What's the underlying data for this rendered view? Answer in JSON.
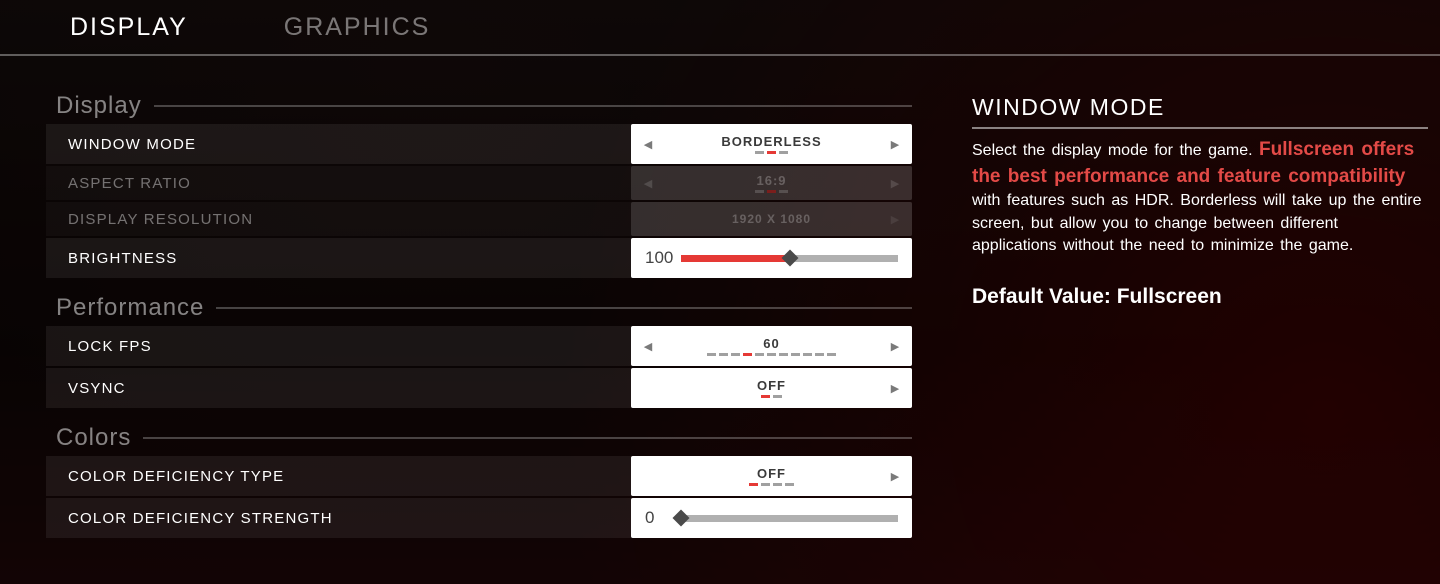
{
  "tabs": {
    "display": "DISPLAY",
    "graphics": "GRAPHICS"
  },
  "sections": {
    "display": "Display",
    "performance": "Performance",
    "colors": "Colors"
  },
  "rows": {
    "window_mode": {
      "label": "WINDOW MODE",
      "value": "BORDERLESS",
      "count": 3,
      "active": 1,
      "left": true,
      "right": true
    },
    "aspect_ratio": {
      "label": "ASPECT RATIO",
      "value": "16:9",
      "count": 3,
      "active": 1,
      "left": true,
      "right": true
    },
    "resolution": {
      "label": "DISPLAY RESOLUTION",
      "value": "1920 X 1080"
    },
    "brightness": {
      "label": "BRIGHTNESS",
      "value": "100",
      "percent": 50
    },
    "lock_fps": {
      "label": "LOCK FPS",
      "value": "60",
      "count": 11,
      "active": 3,
      "left": true,
      "right": true
    },
    "vsync": {
      "label": "VSYNC",
      "value": "OFF",
      "count": 2,
      "active": 0,
      "left": false,
      "right": true
    },
    "cd_type": {
      "label": "COLOR DEFICIENCY TYPE",
      "value": "OFF",
      "count": 4,
      "active": 0,
      "left": false,
      "right": true
    },
    "cd_strength": {
      "label": "COLOR DEFICIENCY STRENGTH",
      "value": "0",
      "percent": 0
    }
  },
  "help": {
    "title": "WINDOW MODE",
    "body_pre": "Select the display mode for the game. ",
    "highlight": "Fullscreen offers the best performance and feature compatibility",
    "body_post": " with features such as HDR. Borderless will take up the entire screen, but allow you to change between different applications without the need to minimize the game.",
    "default_label": "Default Value: ",
    "default_value": "Fullscreen"
  }
}
